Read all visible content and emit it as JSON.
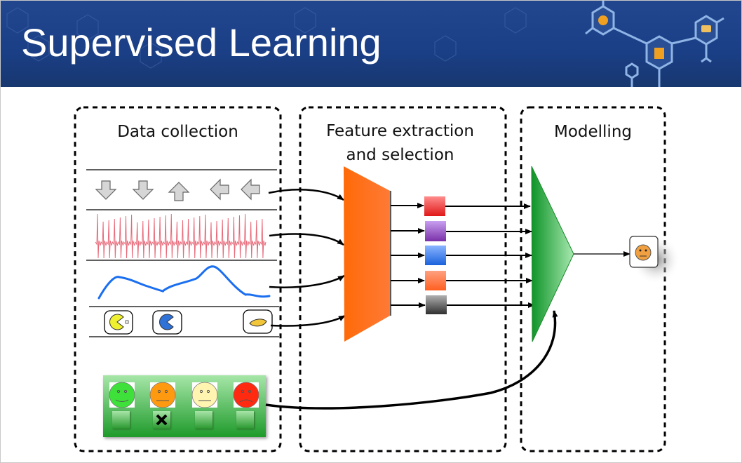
{
  "slide": {
    "title": "Supervised Learning"
  },
  "stages": {
    "data_collection": "Data collection",
    "feature_line1": "Feature extraction",
    "feature_line2": "and selection",
    "modelling": "Modelling"
  },
  "inputs": {
    "arrow_sequence": [
      "arrow-down",
      "arrow-down",
      "arrow-up",
      "arrow-left",
      "arrow-left"
    ],
    "pacman_icons": [
      "pacman-yellow-icon",
      "pacman-blue-icon",
      "yellow-blob-icon"
    ]
  },
  "labels": {
    "faces": [
      "happy",
      "neutral",
      "neutral",
      "sad"
    ],
    "face_colors": [
      "#3ee03a",
      "#ff9a10",
      "#fff4b0",
      "#ff2a10"
    ],
    "selected_index": 1
  },
  "features": {
    "colors": [
      "#e82020",
      "#8a3fb0",
      "#2a6fe0",
      "#ff7040",
      "#404040"
    ]
  },
  "colors": {
    "banner": "#1b3f86",
    "extractor": "#ff6a10",
    "model": "#1a9a30"
  }
}
